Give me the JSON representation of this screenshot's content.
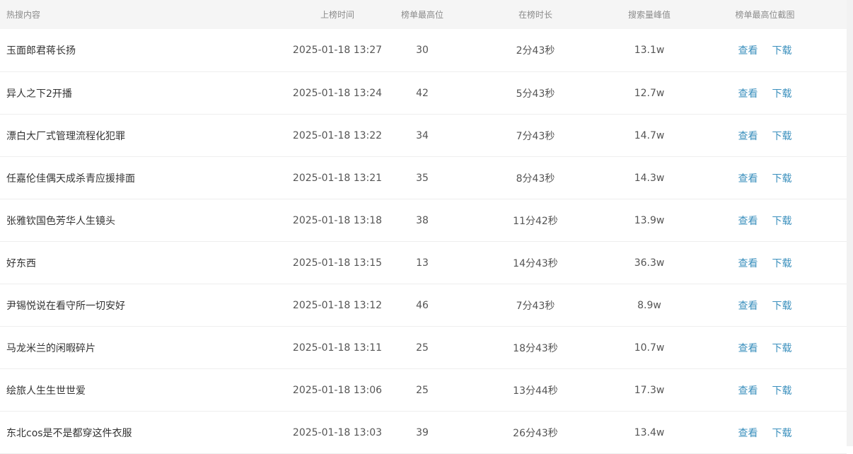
{
  "columns": {
    "title": "热搜内容",
    "time": "上榜时间",
    "rank": "榜单最高位",
    "duration": "在榜时长",
    "peak": "搜索量峰值",
    "screenshot": "榜单最高位截图"
  },
  "actions": {
    "view": "查看",
    "download": "下载"
  },
  "rows": [
    {
      "title": "玉面郎君蒋长扬",
      "time": "2025-01-18 13:27",
      "rank": "30",
      "duration": "2分43秒",
      "peak": "13.1w"
    },
    {
      "title": "异人之下2开播",
      "time": "2025-01-18 13:24",
      "rank": "42",
      "duration": "5分43秒",
      "peak": "12.7w"
    },
    {
      "title": "漂白大厂式管理流程化犯罪",
      "time": "2025-01-18 13:22",
      "rank": "34",
      "duration": "7分43秒",
      "peak": "14.7w"
    },
    {
      "title": "任嘉伦佳偶天成杀青应援排面",
      "time": "2025-01-18 13:21",
      "rank": "35",
      "duration": "8分43秒",
      "peak": "14.3w"
    },
    {
      "title": "张雅钦国色芳华人生镜头",
      "time": "2025-01-18 13:18",
      "rank": "38",
      "duration": "11分42秒",
      "peak": "13.9w"
    },
    {
      "title": "好东西",
      "time": "2025-01-18 13:15",
      "rank": "13",
      "duration": "14分43秒",
      "peak": "36.3w"
    },
    {
      "title": "尹锡悦说在看守所一切安好",
      "time": "2025-01-18 13:12",
      "rank": "46",
      "duration": "7分43秒",
      "peak": "8.9w"
    },
    {
      "title": "马龙米兰的闲暇碎片",
      "time": "2025-01-18 13:11",
      "rank": "25",
      "duration": "18分43秒",
      "peak": "10.7w"
    },
    {
      "title": "绘旅人生生世世爱",
      "time": "2025-01-18 13:06",
      "rank": "25",
      "duration": "13分44秒",
      "peak": "17.3w"
    },
    {
      "title": "东北cos是不是都穿这件衣服",
      "time": "2025-01-18 13:03",
      "rank": "39",
      "duration": "26分43秒",
      "peak": "13.4w"
    }
  ]
}
